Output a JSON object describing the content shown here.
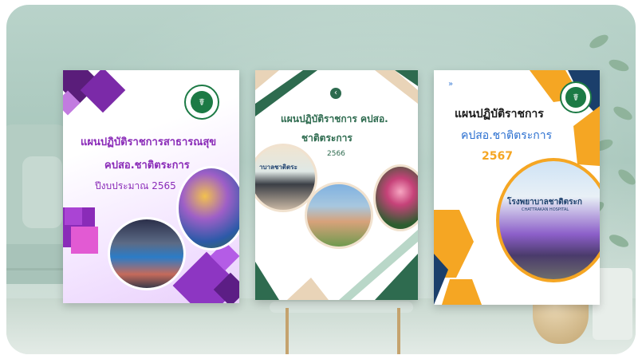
{
  "covers": [
    {
      "title": "แผนปฏิบัติราชการสาธารณสุข",
      "subtitle": "คปสอ.ชาติตระการ",
      "year_line": "ปีงบประมาณ 2565"
    },
    {
      "title": "แผนปฏิบัติราชการ คปสอ.",
      "subtitle": "ชาติตระการ",
      "year": "2566",
      "banner_text": "าบาลชาติตระ"
    },
    {
      "title": "แผนปฏิบัติราชการ",
      "subtitle": "คปสอ.ชาติตระการ",
      "year": "2567",
      "banner_text": "โรงพยาบาลชาติตระก",
      "banner_sub": "CHATTRAKAN HOSPITAL"
    }
  ],
  "colors": {
    "purple": "#8a2bb8",
    "green": "#2e6b4f",
    "orange": "#f5a623",
    "navy": "#1b3f6b"
  }
}
